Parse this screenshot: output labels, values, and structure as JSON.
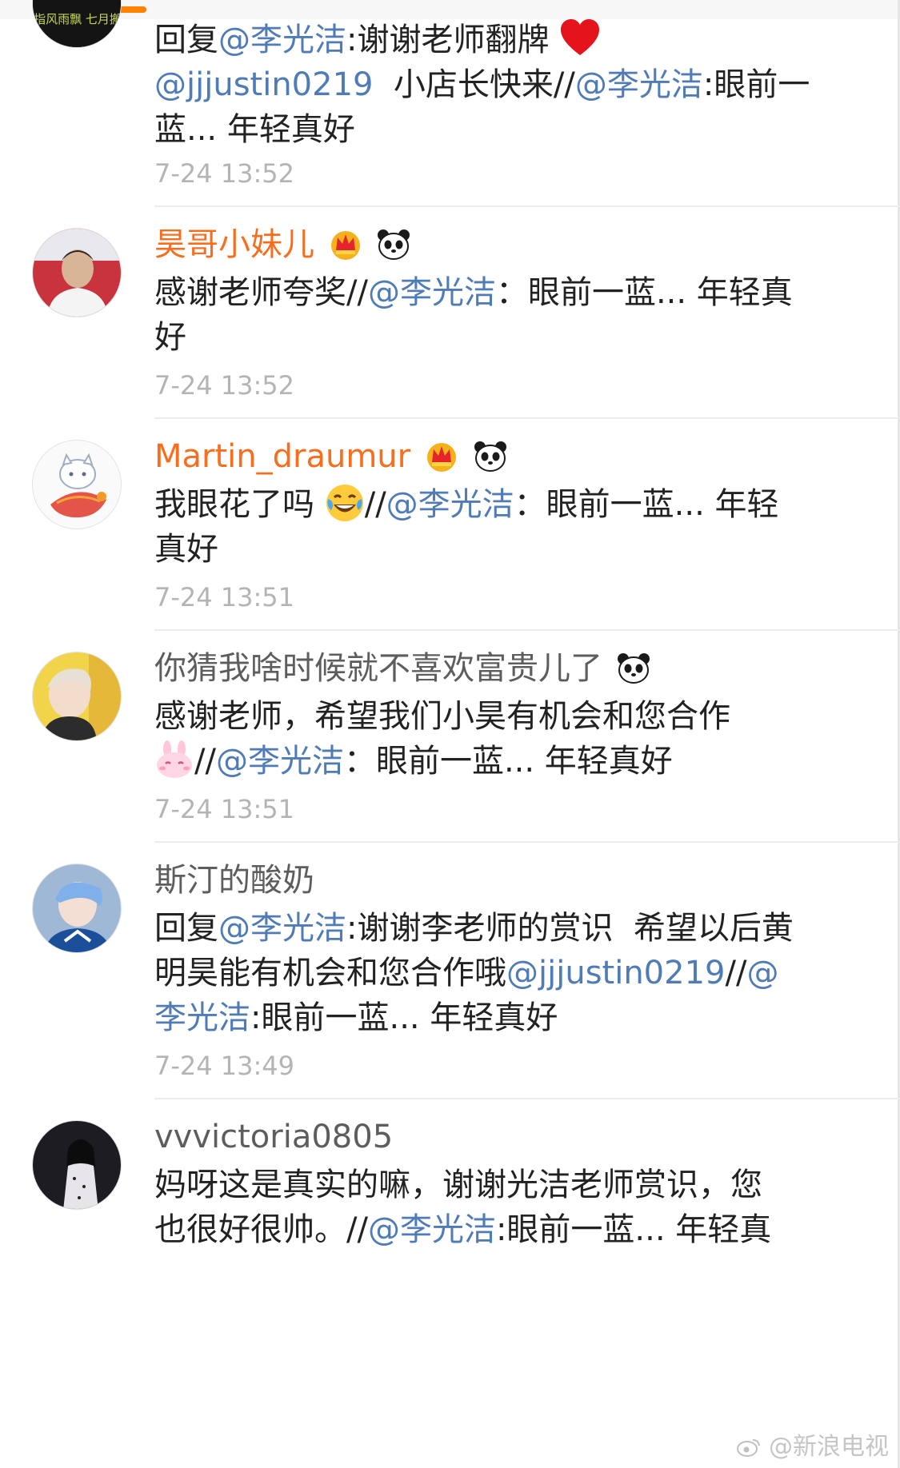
{
  "comments": [
    {
      "reply_prefix": "回复",
      "mention": "@李光洁",
      "line1_rest": ":谢谢老师翻牌",
      "line2_mention": "@jjjustin0219",
      "line2_mid": "  小店长快来//",
      "line2_mention2": "@李光洁",
      "line2_rest": ":眼前一",
      "line3": "蓝... 年轻真好",
      "time": "7-24 13:52",
      "avatar_text": "剑指风雨飘 七月搬家"
    },
    {
      "name": "昊哥小妹儿",
      "line1_start": "感谢老师夸奖//",
      "line1_mention": "@李光洁",
      "line1_rest": "：眼前一蓝... 年轻真",
      "line2": "好",
      "time": "7-24 13:52"
    },
    {
      "name": "Martin_draumur",
      "line1_start": "我眼花了吗",
      "line1_sep": "//",
      "line1_mention": "@李光洁",
      "line1_rest": "：眼前一蓝... 年轻",
      "line2": "真好",
      "time": "7-24 13:51"
    },
    {
      "name": "你猜我啥时候就不喜欢富贵儿了",
      "line1": "感谢老师，希望我们小昊有机会和您合作",
      "line2_sep": "//",
      "line2_mention": "@李光洁",
      "line2_rest": "：眼前一蓝... 年轻真好",
      "time": "7-24 13:51"
    },
    {
      "name": "斯汀的酸奶",
      "reply_prefix": "回复",
      "line1_mention": "@李光洁",
      "line1_rest": ":谢谢李老师的赏识  希望以后黄",
      "line2_start": "明昊能有机会和您合作哦",
      "line2_mention": "@jjjustin0219",
      "line2_sep": "//",
      "line2_mention2": "@",
      "line3_mention": "李光洁",
      "line3_rest": ":眼前一蓝... 年轻真好",
      "time": "7-24 13:49"
    },
    {
      "name": "vvvictoria0805",
      "line1": "妈呀这是真实的嘛，谢谢光洁老师赏识，您",
      "line2_start": "也很好很帅。//",
      "line2_mention": "@李光洁",
      "line2_rest": ":眼前一蓝... 年轻真"
    }
  ],
  "watermark": "@新浪电视",
  "colors": {
    "mention": "#4f7bb7",
    "vip_name": "#f86e1f",
    "time": "#b4b4b4",
    "text": "#222222"
  }
}
